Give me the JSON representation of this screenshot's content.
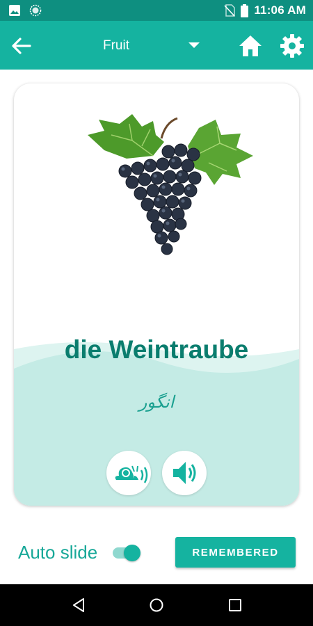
{
  "status_bar": {
    "time": "11:06 AM",
    "icons": [
      "image-icon",
      "sync-icon",
      "no-sim-icon",
      "battery-icon"
    ]
  },
  "app_bar": {
    "category": "Fruit",
    "icons": [
      "back-arrow-icon",
      "dropdown-caret-icon",
      "home-icon",
      "gear-icon"
    ]
  },
  "card": {
    "word": "die Weintraube",
    "translation": "انگور",
    "image": "grapes-icon",
    "buttons": [
      "snail-icon",
      "speaker-icon"
    ]
  },
  "footer": {
    "auto_slide_label": "Auto slide",
    "auto_slide_on": true,
    "remembered_label": "REMEMBERED"
  },
  "colors": {
    "status_bar": "#0e8f80",
    "primary": "#15b3a0",
    "word_text": "#0a7d6e",
    "wave": "#c4ebe5"
  }
}
